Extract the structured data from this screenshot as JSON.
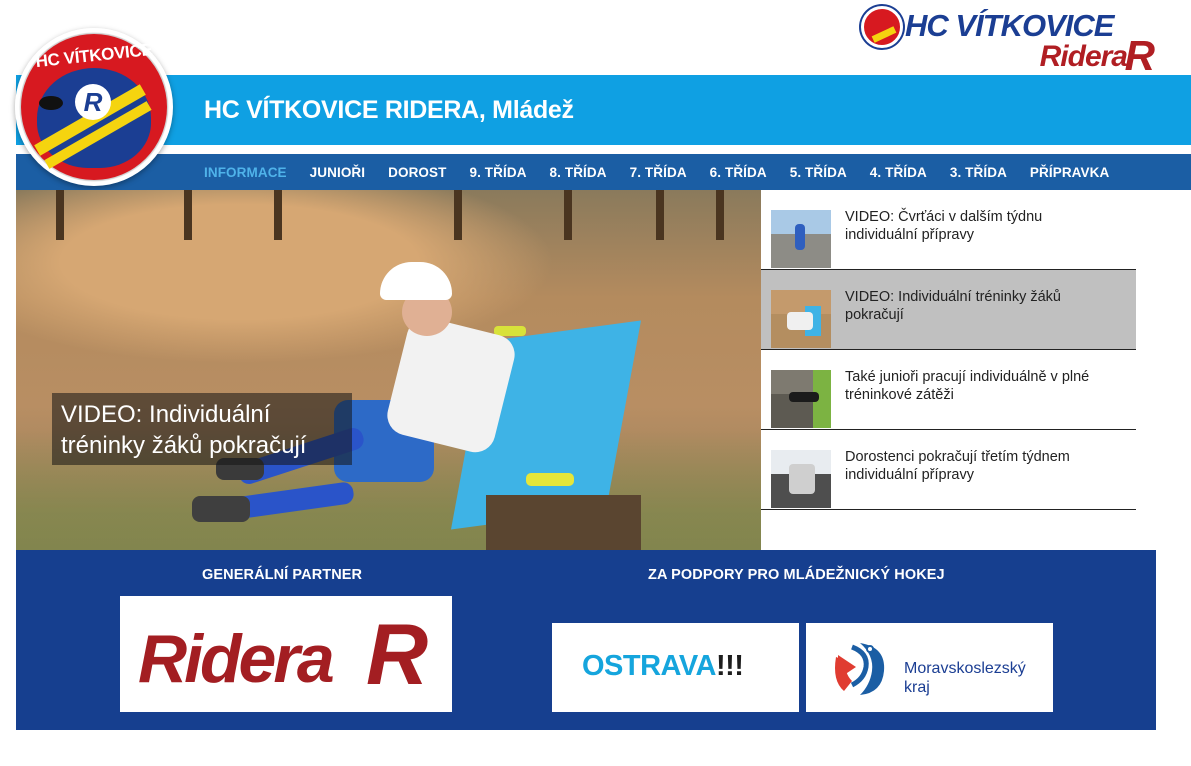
{
  "brand": {
    "title": "HC VÍTKOVICE",
    "sub": "Ridera",
    "r": "R",
    "colors": {
      "blue": "#1b3e93",
      "red": "#b01e23",
      "yellow": "#f5d40f"
    }
  },
  "club_logo": {
    "text": "HC VÍTKOVICE",
    "badge": "R"
  },
  "header": {
    "title": "HC VÍTKOVICE RIDERA, Mládež",
    "bar_color": "#0fa0e3",
    "nav_color": "#1b5ea4"
  },
  "nav": {
    "items": [
      {
        "label": "INFORMACE",
        "active": true
      },
      {
        "label": "JUNIOŘI"
      },
      {
        "label": "DOROST"
      },
      {
        "label": "9. TŘÍDA"
      },
      {
        "label": "8. TŘÍDA"
      },
      {
        "label": "7. TŘÍDA"
      },
      {
        "label": "6. TŘÍDA"
      },
      {
        "label": "5. TŘÍDA"
      },
      {
        "label": "4. TŘÍDA"
      },
      {
        "label": "3. TŘÍDA"
      },
      {
        "label": "PŘÍPRAVKA"
      }
    ]
  },
  "hero": {
    "caption": "VIDEO: Individuální tréninky žáků pokračují"
  },
  "news": {
    "items": [
      {
        "title": "VIDEO: Čvrťáci v dalším týdnu individuální přípravy",
        "active": false
      },
      {
        "title": "VIDEO: Individuální tréninky žáků pokračují",
        "active": true
      },
      {
        "title": "Také junioři pracují individuálně v plné tréninkové zátěži",
        "active": false
      },
      {
        "title": "Dorostenci pokračují třetím týdnem individuální přípravy",
        "active": false
      }
    ]
  },
  "partners": {
    "general_heading": "GENERÁLNÍ PARTNER",
    "support_heading": "ZA PODPORY PRO MLÁDEŽNICKÝ HOKEJ",
    "ridera_text": "Ridera",
    "ridera_r": "R",
    "ostrava_text": "OSTRAVA",
    "ostrava_bang": "!!!",
    "msk_line1": "Moravskoslezský",
    "msk_line2": "kraj",
    "bg_color": "#163f8f"
  }
}
